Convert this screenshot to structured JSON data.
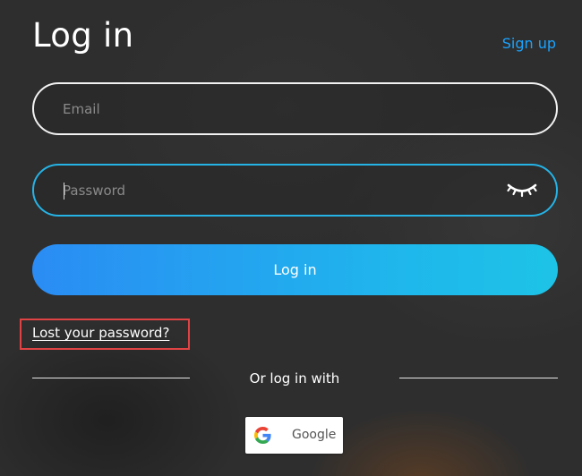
{
  "header": {
    "title": "Log in",
    "signup_label": "Sign up"
  },
  "form": {
    "email": {
      "value": "",
      "placeholder": "Email"
    },
    "password": {
      "value": "",
      "placeholder": "Password",
      "toggle_icon": "eye-closed-icon"
    },
    "submit_label": "Log in",
    "lost_password_label": "Lost your password?"
  },
  "social": {
    "divider_text": "Or log in with",
    "google_label": "Google",
    "google_icon": "google-icon"
  },
  "colors": {
    "accent": "#1aa3ff",
    "button_gradient_start": "#2a8cf4",
    "button_gradient_end": "#1dc3e6",
    "focus_border": "#25b3e6",
    "highlight_box": "#e04343"
  }
}
